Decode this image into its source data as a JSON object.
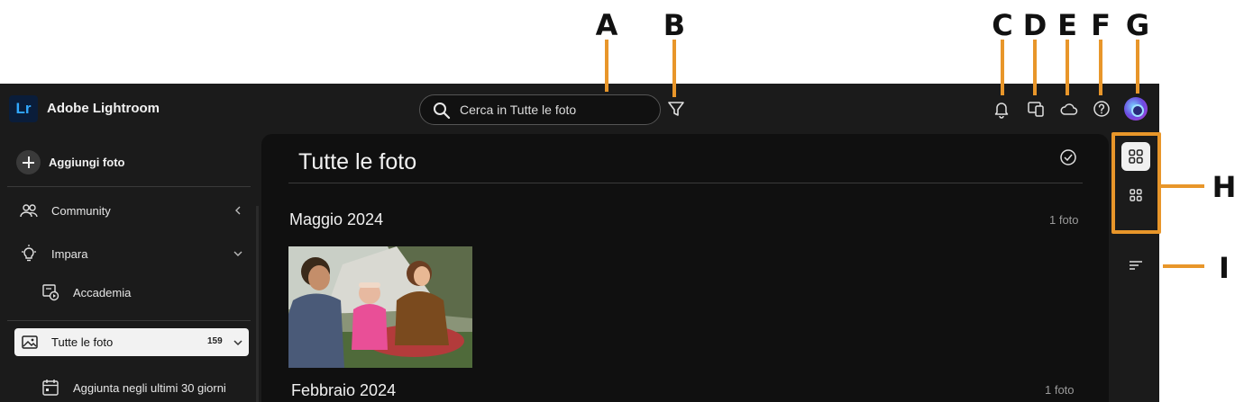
{
  "callouts": {
    "a": "A",
    "b": "B",
    "c": "C",
    "d": "D",
    "e": "E",
    "f": "F",
    "g": "G",
    "h": "H",
    "i": "I"
  },
  "app": {
    "logo_text": "Lr",
    "name": "Adobe Lightroom"
  },
  "search": {
    "placeholder": "Cerca in Tutte le foto"
  },
  "toolbar": {
    "icons": [
      "filter-icon",
      "bell-icon",
      "devices-icon",
      "cloud-icon",
      "help-icon",
      "avatar"
    ]
  },
  "sidebar": {
    "add_label": "Aggiungi foto",
    "items": [
      {
        "label": "Community",
        "icon": "community-icon",
        "chevron": "left"
      },
      {
        "label": "Impara",
        "icon": "lightbulb-icon",
        "chevron": "down"
      },
      {
        "label": "Accademia",
        "icon": "academy-icon"
      },
      {
        "label": "Tutte le foto",
        "icon": "photos-icon",
        "count": "159",
        "chevron": "down",
        "active": true
      },
      {
        "label": "Aggiunta negli ultimi 30 giorni",
        "icon": "calendar-icon"
      }
    ]
  },
  "main": {
    "title": "Tutte le foto",
    "groups": [
      {
        "title": "Maggio 2024",
        "count": "1 foto"
      },
      {
        "title": "Febbraio 2024",
        "count": "1 foto"
      }
    ]
  },
  "colors": {
    "callout": "#e8962a",
    "app_bg": "#1b1b1b",
    "panel_bg": "#101010",
    "accent": "#31a8ff"
  }
}
